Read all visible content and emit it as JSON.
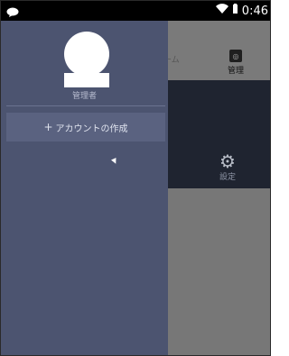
{
  "status_bar": {
    "time": "0:46"
  },
  "drawer": {
    "user_name": "管理者",
    "create_account_label": "アカウントの作成",
    "create_account_prefix": "+"
  },
  "background_tabs": {
    "home_partial": "ーム",
    "admin_label": "管理",
    "settings_label": "設定"
  },
  "colors": {
    "drawer_bg": "#4c5470",
    "button_bg": "#5a6280",
    "dark_panel": "#1f2430"
  }
}
